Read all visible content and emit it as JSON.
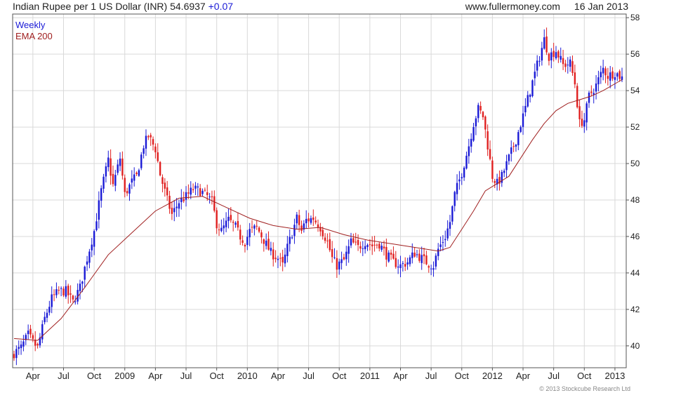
{
  "header": {
    "title": "Indian Rupee per 1 US Dollar (INR)",
    "last_price": "54.6937",
    "change": "+0.07",
    "source": "www.fullermoney.com",
    "date": "16 Jan 2013"
  },
  "footer": {
    "copyright": "© 2013 Stockcube Research Ltd"
  },
  "colors": {
    "up": "#1a1ad6",
    "down": "#e02020",
    "ema": "#a02020",
    "grid": "#d9d9d9",
    "axis": "#555555"
  },
  "chart_data": {
    "type": "candlestick",
    "period_label": "Weekly",
    "indicator_label": "EMA 200",
    "ylim": [
      38.8,
      58.2
    ],
    "y_ticks": [
      40,
      42,
      44,
      46,
      48,
      50,
      52,
      54,
      56,
      58
    ],
    "x_tick_labels": [
      "Apr",
      "Jul",
      "Oct",
      "2009",
      "Apr",
      "Jul",
      "Oct",
      "2010",
      "Apr",
      "Jul",
      "Oct",
      "2011",
      "Apr",
      "Jul",
      "Oct",
      "2012",
      "Apr",
      "Jul",
      "Oct",
      "2013"
    ],
    "x_range_weeks": [
      0,
      250
    ],
    "x_tick_weeks": [
      8,
      21,
      34,
      47,
      60,
      73,
      86,
      99,
      112,
      125,
      138,
      151,
      164,
      177,
      190,
      203,
      216,
      229,
      242,
      255
    ],
    "close_path": [
      [
        0,
        39.6
      ],
      [
        3,
        39.9
      ],
      [
        6,
        40.6
      ],
      [
        8,
        40.2
      ],
      [
        10,
        39.9
      ],
      [
        13,
        41.5
      ],
      [
        16,
        42.6
      ],
      [
        19,
        43.0
      ],
      [
        22,
        43.0
      ],
      [
        25,
        42.4
      ],
      [
        28,
        43.2
      ],
      [
        31,
        44.8
      ],
      [
        34,
        46.3
      ],
      [
        37,
        48.5
      ],
      [
        40,
        50.2
      ],
      [
        42,
        48.8
      ],
      [
        45,
        50.3
      ],
      [
        47,
        48.3
      ],
      [
        50,
        49.0
      ],
      [
        52,
        49.3
      ],
      [
        55,
        51.0
      ],
      [
        57,
        51.5
      ],
      [
        60,
        50.8
      ],
      [
        62,
        49.4
      ],
      [
        65,
        48.0
      ],
      [
        67,
        47.2
      ],
      [
        70,
        47.9
      ],
      [
        73,
        48.2
      ],
      [
        76,
        48.6
      ],
      [
        79,
        48.5
      ],
      [
        82,
        48.2
      ],
      [
        84,
        47.9
      ],
      [
        86,
        46.7
      ],
      [
        88,
        46.3
      ],
      [
        91,
        46.9
      ],
      [
        94,
        46.5
      ],
      [
        96,
        46.0
      ],
      [
        98,
        45.7
      ],
      [
        100,
        46.3
      ],
      [
        103,
        46.5
      ],
      [
        106,
        45.8
      ],
      [
        109,
        45.1
      ],
      [
        112,
        44.8
      ],
      [
        114,
        44.4
      ],
      [
        116,
        45.4
      ],
      [
        118,
        46.2
      ],
      [
        120,
        47.0
      ],
      [
        122,
        46.3
      ],
      [
        124,
        46.9
      ],
      [
        127,
        47.0
      ],
      [
        130,
        46.5
      ],
      [
        133,
        45.7
      ],
      [
        135,
        44.8
      ],
      [
        137,
        44.4
      ],
      [
        140,
        44.7
      ],
      [
        143,
        45.7
      ],
      [
        146,
        45.4
      ],
      [
        149,
        45.7
      ],
      [
        152,
        45.5
      ],
      [
        155,
        45.6
      ],
      [
        158,
        45.0
      ],
      [
        161,
        44.6
      ],
      [
        164,
        44.4
      ],
      [
        167,
        44.6
      ],
      [
        170,
        45.1
      ],
      [
        173,
        44.8
      ],
      [
        176,
        44.5
      ],
      [
        178,
        44.4
      ],
      [
        180,
        45.3
      ],
      [
        183,
        46.0
      ],
      [
        185,
        46.8
      ],
      [
        187,
        48.3
      ],
      [
        190,
        49.5
      ],
      [
        193,
        51.0
      ],
      [
        195,
        52.2
      ],
      [
        197,
        53.0
      ],
      [
        199,
        52.6
      ],
      [
        201,
        51.0
      ],
      [
        203,
        49.3
      ],
      [
        205,
        48.9
      ],
      [
        207,
        49.3
      ],
      [
        210,
        50.3
      ],
      [
        213,
        51.3
      ],
      [
        216,
        52.6
      ],
      [
        219,
        54.0
      ],
      [
        222,
        55.4
      ],
      [
        225,
        56.8
      ],
      [
        227,
        55.9
      ],
      [
        230,
        56.2
      ],
      [
        233,
        55.4
      ],
      [
        236,
        55.5
      ],
      [
        238,
        54.4
      ],
      [
        240,
        52.2
      ],
      [
        242,
        52.4
      ],
      [
        244,
        53.7
      ],
      [
        247,
        54.3
      ],
      [
        250,
        55.2
      ],
      [
        252,
        54.8
      ],
      [
        255,
        55.0
      ],
      [
        258,
        54.7
      ]
    ],
    "ema_path": [
      [
        0,
        40.4
      ],
      [
        10,
        40.3
      ],
      [
        20,
        41.5
      ],
      [
        30,
        43.2
      ],
      [
        40,
        45.0
      ],
      [
        50,
        46.2
      ],
      [
        60,
        47.4
      ],
      [
        70,
        48.1
      ],
      [
        80,
        48.2
      ],
      [
        90,
        47.6
      ],
      [
        100,
        47.0
      ],
      [
        110,
        46.6
      ],
      [
        120,
        46.4
      ],
      [
        130,
        46.5
      ],
      [
        140,
        46.1
      ],
      [
        150,
        45.8
      ],
      [
        160,
        45.6
      ],
      [
        170,
        45.4
      ],
      [
        180,
        45.2
      ],
      [
        185,
        45.4
      ],
      [
        190,
        46.4
      ],
      [
        195,
        47.4
      ],
      [
        200,
        48.5
      ],
      [
        205,
        48.9
      ],
      [
        210,
        49.3
      ],
      [
        215,
        50.3
      ],
      [
        220,
        51.3
      ],
      [
        225,
        52.2
      ],
      [
        230,
        52.9
      ],
      [
        235,
        53.3
      ],
      [
        240,
        53.5
      ],
      [
        245,
        53.7
      ],
      [
        250,
        54.0
      ],
      [
        258,
        54.6
      ]
    ]
  }
}
